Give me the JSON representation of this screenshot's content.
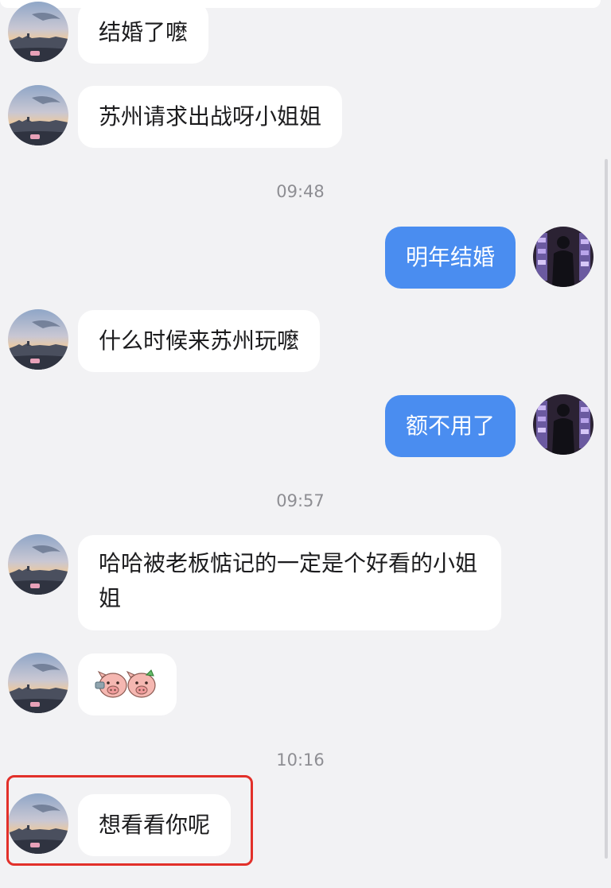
{
  "conversation": {
    "messages": [
      {
        "sender": "other",
        "text": "结婚了嚒"
      },
      {
        "sender": "other",
        "text": "苏州请求出战呀小姐姐"
      },
      {
        "type": "time",
        "text": "09:48"
      },
      {
        "sender": "me",
        "text": "明年结婚"
      },
      {
        "sender": "other",
        "text": "什么时候来苏州玩嚒"
      },
      {
        "sender": "me",
        "text": "额不用了"
      },
      {
        "type": "time",
        "text": "09:57"
      },
      {
        "sender": "other",
        "text": "哈哈被老板惦记的一定是个好看的小姐姐"
      },
      {
        "sender": "other",
        "type": "sticker",
        "icon": "pig-emoji-sticker"
      },
      {
        "type": "time",
        "text": "10:16"
      },
      {
        "sender": "other",
        "text": "想看看你呢",
        "highlighted": true
      }
    ]
  },
  "colors": {
    "background": "#f2f2f4",
    "other_bubble": "#ffffff",
    "my_bubble": "#4a8df0",
    "highlight": "#e2302a"
  }
}
